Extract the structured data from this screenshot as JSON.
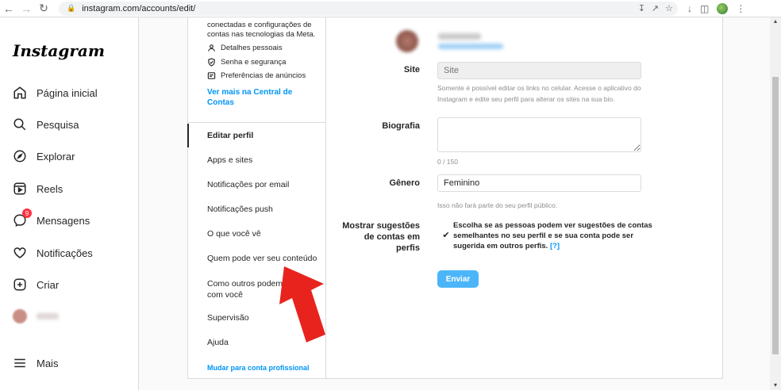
{
  "browser": {
    "url": "instagram.com/accounts/edit/"
  },
  "nav": {
    "logo": "Instagram",
    "items": [
      {
        "label": "Página inicial",
        "icon": "home-icon"
      },
      {
        "label": "Pesquisa",
        "icon": "search-icon"
      },
      {
        "label": "Explorar",
        "icon": "compass-icon"
      },
      {
        "label": "Reels",
        "icon": "reels-icon"
      },
      {
        "label": "Mensagens",
        "icon": "messenger-icon",
        "badge": "9"
      },
      {
        "label": "Notificações",
        "icon": "heart-icon"
      },
      {
        "label": "Criar",
        "icon": "plus-square-icon"
      },
      {
        "label": "Perfil",
        "icon": "avatar"
      }
    ],
    "more": "Mais"
  },
  "meta": {
    "text": "conectadas e configurações de contas nas tecnologias da Meta.",
    "links": [
      {
        "label": "Detalhes pessoais",
        "icon": "person-icon"
      },
      {
        "label": "Senha e segurança",
        "icon": "shield-icon"
      },
      {
        "label": "Preferências de anúncios",
        "icon": "ad-icon"
      }
    ],
    "center_link": "Ver mais na Central de Contas"
  },
  "settings": {
    "items": [
      "Editar perfil",
      "Apps e sites",
      "Notificações por email",
      "Notificações push",
      "O que você vê",
      "Quem pode ver seu conteúdo",
      "Como outros podem interagir com você",
      "Supervisão",
      "Ajuda"
    ],
    "pro_link": "Mudar para conta profissional"
  },
  "form": {
    "site_label": "Site",
    "site_placeholder": "Site",
    "site_help": "Somente é possível editar os links no celular. Acesse o aplicativo do Instagram e edite seu perfil para alterar os sites na sua bio.",
    "bio_label": "Biografia",
    "bio_count": "0 / 150",
    "gender_label": "Gênero",
    "gender_value": "Feminino",
    "gender_help": "Isso não fará parte do seu perfil público.",
    "suggest_label": "Mostrar sugestões de contas em perfis",
    "suggest_text": "Escolha se as pessoas podem ver sugestões de contas semelhantes no seu perfil e se sua conta pode ser sugerida em outros perfis.",
    "suggest_help_link": "[?]",
    "suggest_checked": true,
    "submit_label": "Enviar"
  },
  "colors": {
    "accent": "#0095f6",
    "submit": "#4cb5f9",
    "arrow": "#e8231e"
  }
}
